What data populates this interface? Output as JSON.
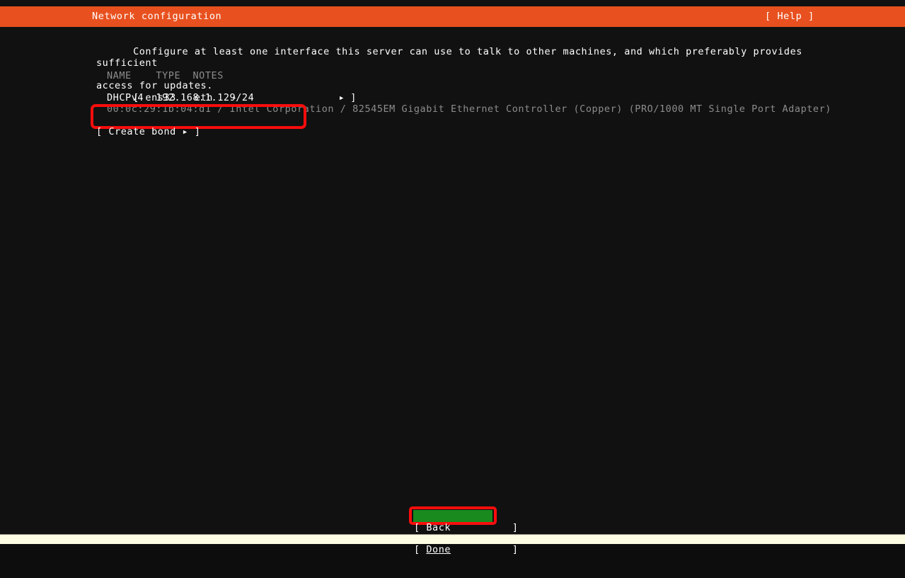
{
  "header": {
    "title": "Network configuration",
    "help_label": "[ Help ]",
    "bg_color": "#e8511f",
    "fg_color": "#ffffff"
  },
  "description": {
    "line1": "Configure at least one interface this server can use to talk to other machines, and which preferably provides sufficient",
    "line2": "access for updates."
  },
  "interfaces_table": {
    "columns": [
      "NAME",
      "TYPE",
      "NOTES"
    ],
    "header_text": "NAME    TYPE  NOTES",
    "header_color": "#8c8c8c",
    "rows": [
      {
        "bracket_open": "[",
        "name": "ens33",
        "type": "eth",
        "notes": "-",
        "row_text": "[ ens33   eth   -",
        "arrow_icon": "▸",
        "bracket_close": "]",
        "detail_label": "DHCPv4",
        "detail_value": "192.168.1.129/24",
        "detail_text": "DHCPv4  192.168.1.129/24",
        "hardware": "00:0c:29:1b:04:d1 / Intel Corporation / 82545EM Gigabit Ethernet Controller (Copper) (PRO/1000 MT Single Port Adapter)"
      }
    ]
  },
  "actions": {
    "create_bond": "[ Create bond ▸ ]"
  },
  "footer": {
    "done_open": "[ ",
    "done_label": "Done",
    "done_close": "          ]",
    "done_highlight_color": "#198a1e",
    "back_label": "[ Back          ]"
  },
  "annotations": {
    "color": "#fb0d0d",
    "interface_box": "highlight-selected-interface",
    "done_box": "highlight-done-button"
  }
}
